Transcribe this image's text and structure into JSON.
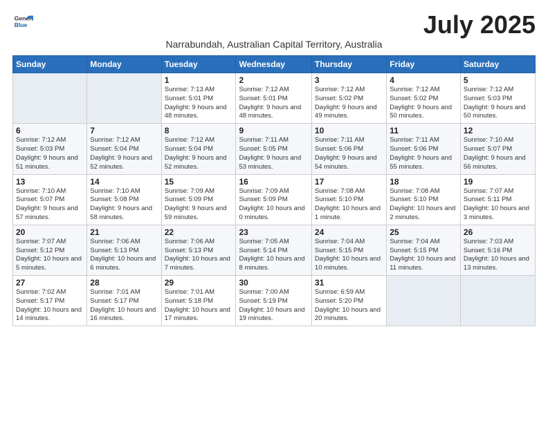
{
  "header": {
    "logo_general": "General",
    "logo_blue": "Blue",
    "month_year": "July 2025",
    "subtitle": "Narrabundah, Australian Capital Territory, Australia"
  },
  "weekdays": [
    "Sunday",
    "Monday",
    "Tuesday",
    "Wednesday",
    "Thursday",
    "Friday",
    "Saturday"
  ],
  "weeks": [
    [
      {
        "day": "",
        "info": ""
      },
      {
        "day": "",
        "info": ""
      },
      {
        "day": "1",
        "info": "Sunrise: 7:13 AM\nSunset: 5:01 PM\nDaylight: 9 hours and 48 minutes."
      },
      {
        "day": "2",
        "info": "Sunrise: 7:12 AM\nSunset: 5:01 PM\nDaylight: 9 hours and 48 minutes."
      },
      {
        "day": "3",
        "info": "Sunrise: 7:12 AM\nSunset: 5:02 PM\nDaylight: 9 hours and 49 minutes."
      },
      {
        "day": "4",
        "info": "Sunrise: 7:12 AM\nSunset: 5:02 PM\nDaylight: 9 hours and 50 minutes."
      },
      {
        "day": "5",
        "info": "Sunrise: 7:12 AM\nSunset: 5:03 PM\nDaylight: 9 hours and 50 minutes."
      }
    ],
    [
      {
        "day": "6",
        "info": "Sunrise: 7:12 AM\nSunset: 5:03 PM\nDaylight: 9 hours and 51 minutes."
      },
      {
        "day": "7",
        "info": "Sunrise: 7:12 AM\nSunset: 5:04 PM\nDaylight: 9 hours and 52 minutes."
      },
      {
        "day": "8",
        "info": "Sunrise: 7:12 AM\nSunset: 5:04 PM\nDaylight: 9 hours and 52 minutes."
      },
      {
        "day": "9",
        "info": "Sunrise: 7:11 AM\nSunset: 5:05 PM\nDaylight: 9 hours and 53 minutes."
      },
      {
        "day": "10",
        "info": "Sunrise: 7:11 AM\nSunset: 5:06 PM\nDaylight: 9 hours and 54 minutes."
      },
      {
        "day": "11",
        "info": "Sunrise: 7:11 AM\nSunset: 5:06 PM\nDaylight: 9 hours and 55 minutes."
      },
      {
        "day": "12",
        "info": "Sunrise: 7:10 AM\nSunset: 5:07 PM\nDaylight: 9 hours and 56 minutes."
      }
    ],
    [
      {
        "day": "13",
        "info": "Sunrise: 7:10 AM\nSunset: 5:07 PM\nDaylight: 9 hours and 57 minutes."
      },
      {
        "day": "14",
        "info": "Sunrise: 7:10 AM\nSunset: 5:08 PM\nDaylight: 9 hours and 58 minutes."
      },
      {
        "day": "15",
        "info": "Sunrise: 7:09 AM\nSunset: 5:09 PM\nDaylight: 9 hours and 59 minutes."
      },
      {
        "day": "16",
        "info": "Sunrise: 7:09 AM\nSunset: 5:09 PM\nDaylight: 10 hours and 0 minutes."
      },
      {
        "day": "17",
        "info": "Sunrise: 7:08 AM\nSunset: 5:10 PM\nDaylight: 10 hours and 1 minute."
      },
      {
        "day": "18",
        "info": "Sunrise: 7:08 AM\nSunset: 5:10 PM\nDaylight: 10 hours and 2 minutes."
      },
      {
        "day": "19",
        "info": "Sunrise: 7:07 AM\nSunset: 5:11 PM\nDaylight: 10 hours and 3 minutes."
      }
    ],
    [
      {
        "day": "20",
        "info": "Sunrise: 7:07 AM\nSunset: 5:12 PM\nDaylight: 10 hours and 5 minutes."
      },
      {
        "day": "21",
        "info": "Sunrise: 7:06 AM\nSunset: 5:13 PM\nDaylight: 10 hours and 6 minutes."
      },
      {
        "day": "22",
        "info": "Sunrise: 7:06 AM\nSunset: 5:13 PM\nDaylight: 10 hours and 7 minutes."
      },
      {
        "day": "23",
        "info": "Sunrise: 7:05 AM\nSunset: 5:14 PM\nDaylight: 10 hours and 8 minutes."
      },
      {
        "day": "24",
        "info": "Sunrise: 7:04 AM\nSunset: 5:15 PM\nDaylight: 10 hours and 10 minutes."
      },
      {
        "day": "25",
        "info": "Sunrise: 7:04 AM\nSunset: 5:15 PM\nDaylight: 10 hours and 11 minutes."
      },
      {
        "day": "26",
        "info": "Sunrise: 7:03 AM\nSunset: 5:16 PM\nDaylight: 10 hours and 13 minutes."
      }
    ],
    [
      {
        "day": "27",
        "info": "Sunrise: 7:02 AM\nSunset: 5:17 PM\nDaylight: 10 hours and 14 minutes."
      },
      {
        "day": "28",
        "info": "Sunrise: 7:01 AM\nSunset: 5:17 PM\nDaylight: 10 hours and 16 minutes."
      },
      {
        "day": "29",
        "info": "Sunrise: 7:01 AM\nSunset: 5:18 PM\nDaylight: 10 hours and 17 minutes."
      },
      {
        "day": "30",
        "info": "Sunrise: 7:00 AM\nSunset: 5:19 PM\nDaylight: 10 hours and 19 minutes."
      },
      {
        "day": "31",
        "info": "Sunrise: 6:59 AM\nSunset: 5:20 PM\nDaylight: 10 hours and 20 minutes."
      },
      {
        "day": "",
        "info": ""
      },
      {
        "day": "",
        "info": ""
      }
    ]
  ]
}
